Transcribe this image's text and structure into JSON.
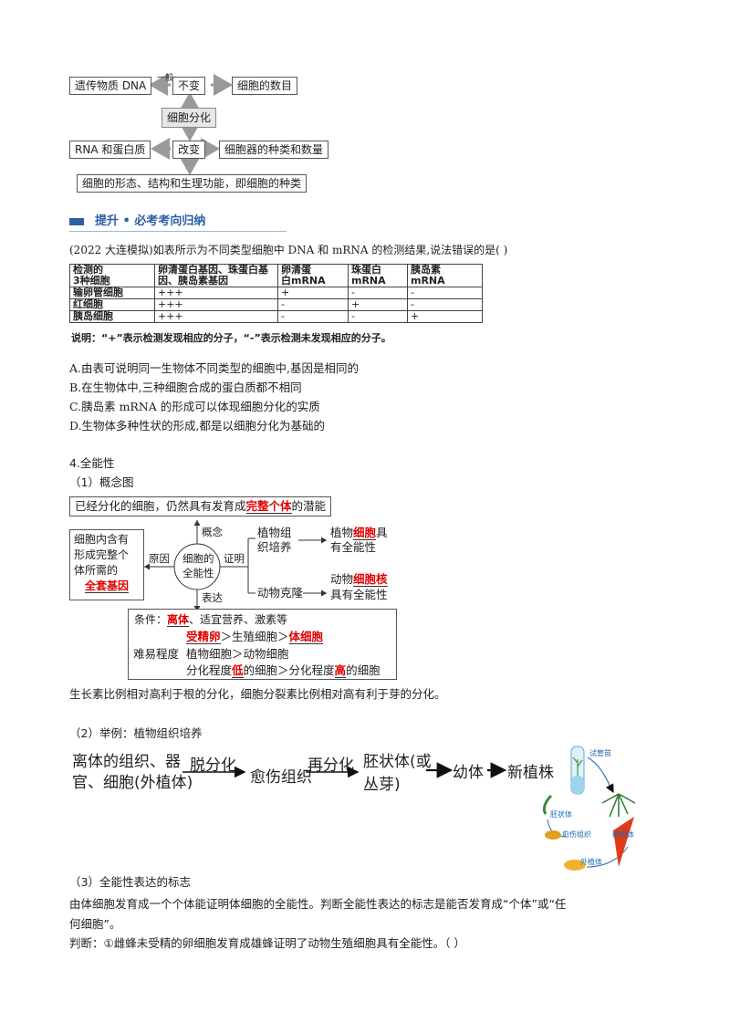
{
  "diagram1": {
    "inherited_material": "遗传物质 DNA",
    "yiban": "一般",
    "unchanged": "不变",
    "cell_count": "细胞的数目",
    "differentiation": "细胞分化",
    "rna_protein": "RNA 和蛋白质",
    "changed": "改变",
    "organelle": "细胞器的种类和数量",
    "result": "细胞的形态、结构和生理功能，即细胞的种类"
  },
  "section": {
    "title": "提升 • 必考考向归纳"
  },
  "question1": {
    "stem": "(2022 大连模拟)如表所示为不同类型细胞中 DNA 和 mRNA 的检测结果,说法错误的是(       )",
    "table": {
      "headers": [
        "检测的\n3种细胞",
        "卵清蛋白基因、珠蛋白基因、胰岛素基因",
        "卵清蛋白mRNA",
        "珠蛋白mRNA",
        "胰岛素mRNA"
      ],
      "rows": [
        [
          "输卵管细胞",
          "+++",
          "+",
          "-",
          "-"
        ],
        [
          "红细胞",
          "+++",
          "-",
          "+",
          "-"
        ],
        [
          "胰岛细胞",
          "+++",
          "-",
          "-",
          "+"
        ]
      ],
      "note": "说明：“+”表示检测发现相应的分子，“-”表示检测未发现相应的分子。"
    },
    "options": [
      "A.由表可说明同一生物体不同类型的细胞中,基因是相同的",
      "B.在生物体中,三种细胞合成的蛋白质都不相同",
      "C.胰岛素 mRNA 的形成可以体现细胞分化的实质",
      "D.生物体多种性状的形成,都是以细胞分化为基础的"
    ]
  },
  "totipotency": {
    "heading": "4.全能性",
    "sub1": "（1）概念图",
    "def_pre": "已经分化的细胞，仍然具有发育成",
    "def_red": "完整个体",
    "def_post": "的潜能",
    "concept": "概念",
    "cause": "原因",
    "proof": "证明",
    "express": "表达",
    "center_top": "细胞的",
    "center_bot": "全能性",
    "left_l1": "细胞内含有",
    "left_l2": "形成完整个",
    "left_l3": "体所需的",
    "left_red": "全套基因",
    "plant_tc_1": "植物组",
    "plant_tc_2": "织培养",
    "plant_cell_pre": "植物",
    "plant_cell_red": "细胞",
    "plant_cell_post": "具",
    "plant_cell_l2": "有全能性",
    "animal_clone": "动物克隆",
    "animal_pre": "动物",
    "animal_red": "细胞核",
    "animal_l2": "具有全能性",
    "cond_pre": "条件：",
    "cond_red": "离体",
    "cond_post": "、适宜营养、激素等",
    "difficulty": "难易程度",
    "d1_red1": "受精卵",
    "d1_mid": "＞生殖细胞＞",
    "d1_red2": "体细胞",
    "d2": "植物细胞＞动物细胞",
    "d3_pre": "分化程度",
    "d3_red1": "低",
    "d3_mid": "的细胞＞分化程度",
    "d3_red2": "高",
    "d3_post": "的细胞",
    "hormone_note": "生长素比例相对高利于根的分化，细胞分裂素比例相对高有利于芽的分化。",
    "sub2": "（2）举例：植物组织培养",
    "flow_1a": "离体的组织、器",
    "flow_1b": "官、细胞(外植体)",
    "flow_a1": "脱分化",
    "flow_2": "愈伤组织",
    "flow_a2": "再分化",
    "flow_3a": "胚状体(或",
    "flow_3b": "丛芽)",
    "flow_4": "幼体",
    "flow_5": "新植株",
    "img_l1": "试管苗",
    "img_l2": "胚状体",
    "img_l3": "愈伤组织",
    "img_l4": "植物体",
    "img_l5": "外植体",
    "sub3": "（3）全能性表达的标志",
    "p1": "由体细胞发育成一个个体能证明体细胞的全能性。判断全能性表达的标志是能否发育成“个体”或“任",
    "p2": "何细胞”。",
    "judge": "判断：①雌蜂未受精的卵细胞发育成雄蜂证明了动物生殖细胞具有全能性。（       ）"
  }
}
